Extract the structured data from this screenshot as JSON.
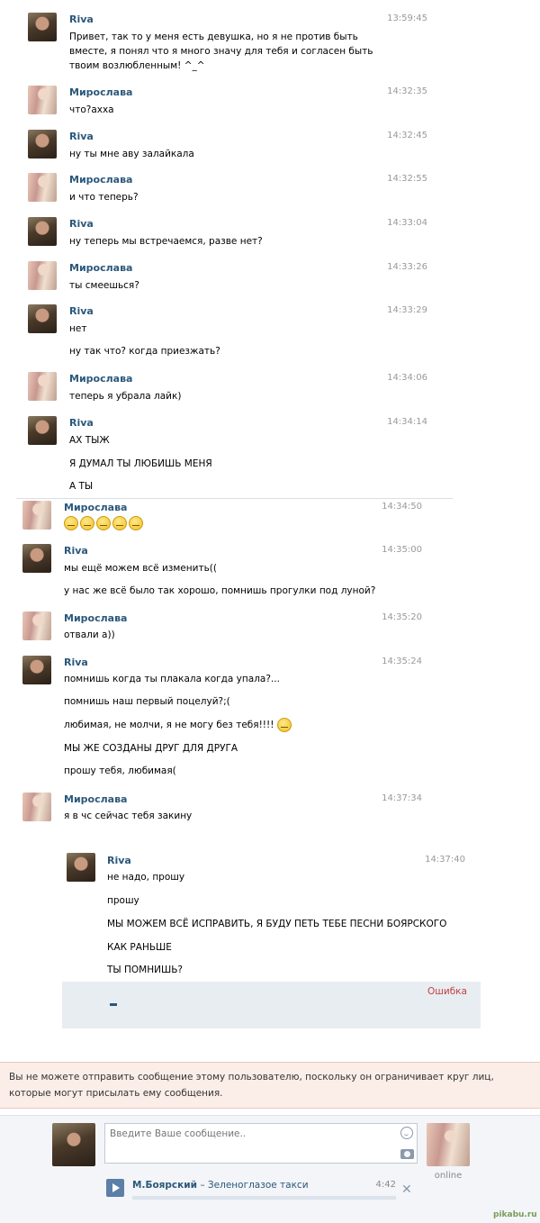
{
  "messages": [
    {
      "author": "Riva",
      "avatar": "riva",
      "time": "13:59:45",
      "lines": [
        "Привет, так то у меня есть девушка, но я не против быть вместе, я понял что я много значу для тебя и согласен быть твоим возлюбленным! ^_^"
      ]
    },
    {
      "author": "Мирослава",
      "avatar": "mir",
      "time": "14:32:35",
      "lines": [
        "что?ахха"
      ]
    },
    {
      "author": "Riva",
      "avatar": "riva",
      "time": "14:32:45",
      "lines": [
        "ну ты мне аву залайкала"
      ]
    },
    {
      "author": "Мирослава",
      "avatar": "mir",
      "time": "14:32:55",
      "lines": [
        "и что теперь?"
      ]
    },
    {
      "author": "Riva",
      "avatar": "riva",
      "time": "14:33:04",
      "lines": [
        "ну теперь мы встречаемся, разве нет?"
      ]
    },
    {
      "author": "Мирослава",
      "avatar": "mir",
      "time": "14:33:26",
      "lines": [
        "ты смеешься?"
      ]
    },
    {
      "author": "Riva",
      "avatar": "riva",
      "time": "14:33:29",
      "lines": [
        "нет",
        "ну так что? когда приезжать?"
      ]
    },
    {
      "author": "Мирослава",
      "avatar": "mir",
      "time": "14:34:06",
      "lines": [
        "теперь я убрала лайк)"
      ]
    },
    {
      "author": "Riva",
      "avatar": "riva",
      "time": "14:34:14",
      "lines": [
        "АХ ТЫЖ",
        "Я ДУМАЛ ТЫ ЛЮБИШЬ МЕНЯ",
        "А ТЫ"
      ]
    },
    {
      "author": "Мирослава",
      "avatar": "mir",
      "time": "14:34:50",
      "lines": [
        ""
      ]
    },
    {
      "author": "Riva",
      "avatar": "riva",
      "time": "14:35:00",
      "lines": [
        "мы ещё можем всё изменить((",
        "у нас же всё было так хорошо, помнишь прогулки под луной?"
      ]
    },
    {
      "author": "Мирослава",
      "avatar": "mir",
      "time": "14:35:20",
      "lines": [
        "отвали а))"
      ]
    },
    {
      "author": "Riva",
      "avatar": "riva",
      "time": "14:35:24",
      "lines": [
        "помнишь когда ты плакала когда упала?...",
        "помнишь наш первый поцелуй?;(",
        "любимая, не молчи, я не могу без тебя!!!!",
        "МЫ ЖЕ СОЗДАНЫ ДРУГ ДЛЯ ДРУГА",
        "прошу тебя, любимая("
      ]
    },
    {
      "author": "Мирослава",
      "avatar": "mir",
      "time": "14:37:34",
      "lines": [
        "я в чс сейчас тебя закину"
      ]
    },
    {
      "author": "Riva",
      "avatar": "riva",
      "time": "14:37:40",
      "lines": [
        "не надо, прошу",
        "прошу",
        "МЫ МОЖЕМ ВСЁ ИСПРАВИТЬ, Я БУДУ ПЕТЬ ТЕБЕ ПЕСНИ БОЯРСКОГО",
        "КАК РАНЬШЕ",
        "ТЫ ПОМНИШЬ?"
      ]
    }
  ],
  "error_label": "Ошибка",
  "notice": "Вы не можете отправить сообщение этому пользователю, поскольку он ограничивает круг лиц, которые могут присылать ему сообщения.",
  "composer": {
    "placeholder": "Введите Ваше сообщение..",
    "online_label": "online"
  },
  "audio": {
    "artist": "М.Боярский",
    "separator": " – ",
    "title": "Зеленоглазое такси",
    "duration": "4:42"
  },
  "watermark": "pikabu.ru"
}
